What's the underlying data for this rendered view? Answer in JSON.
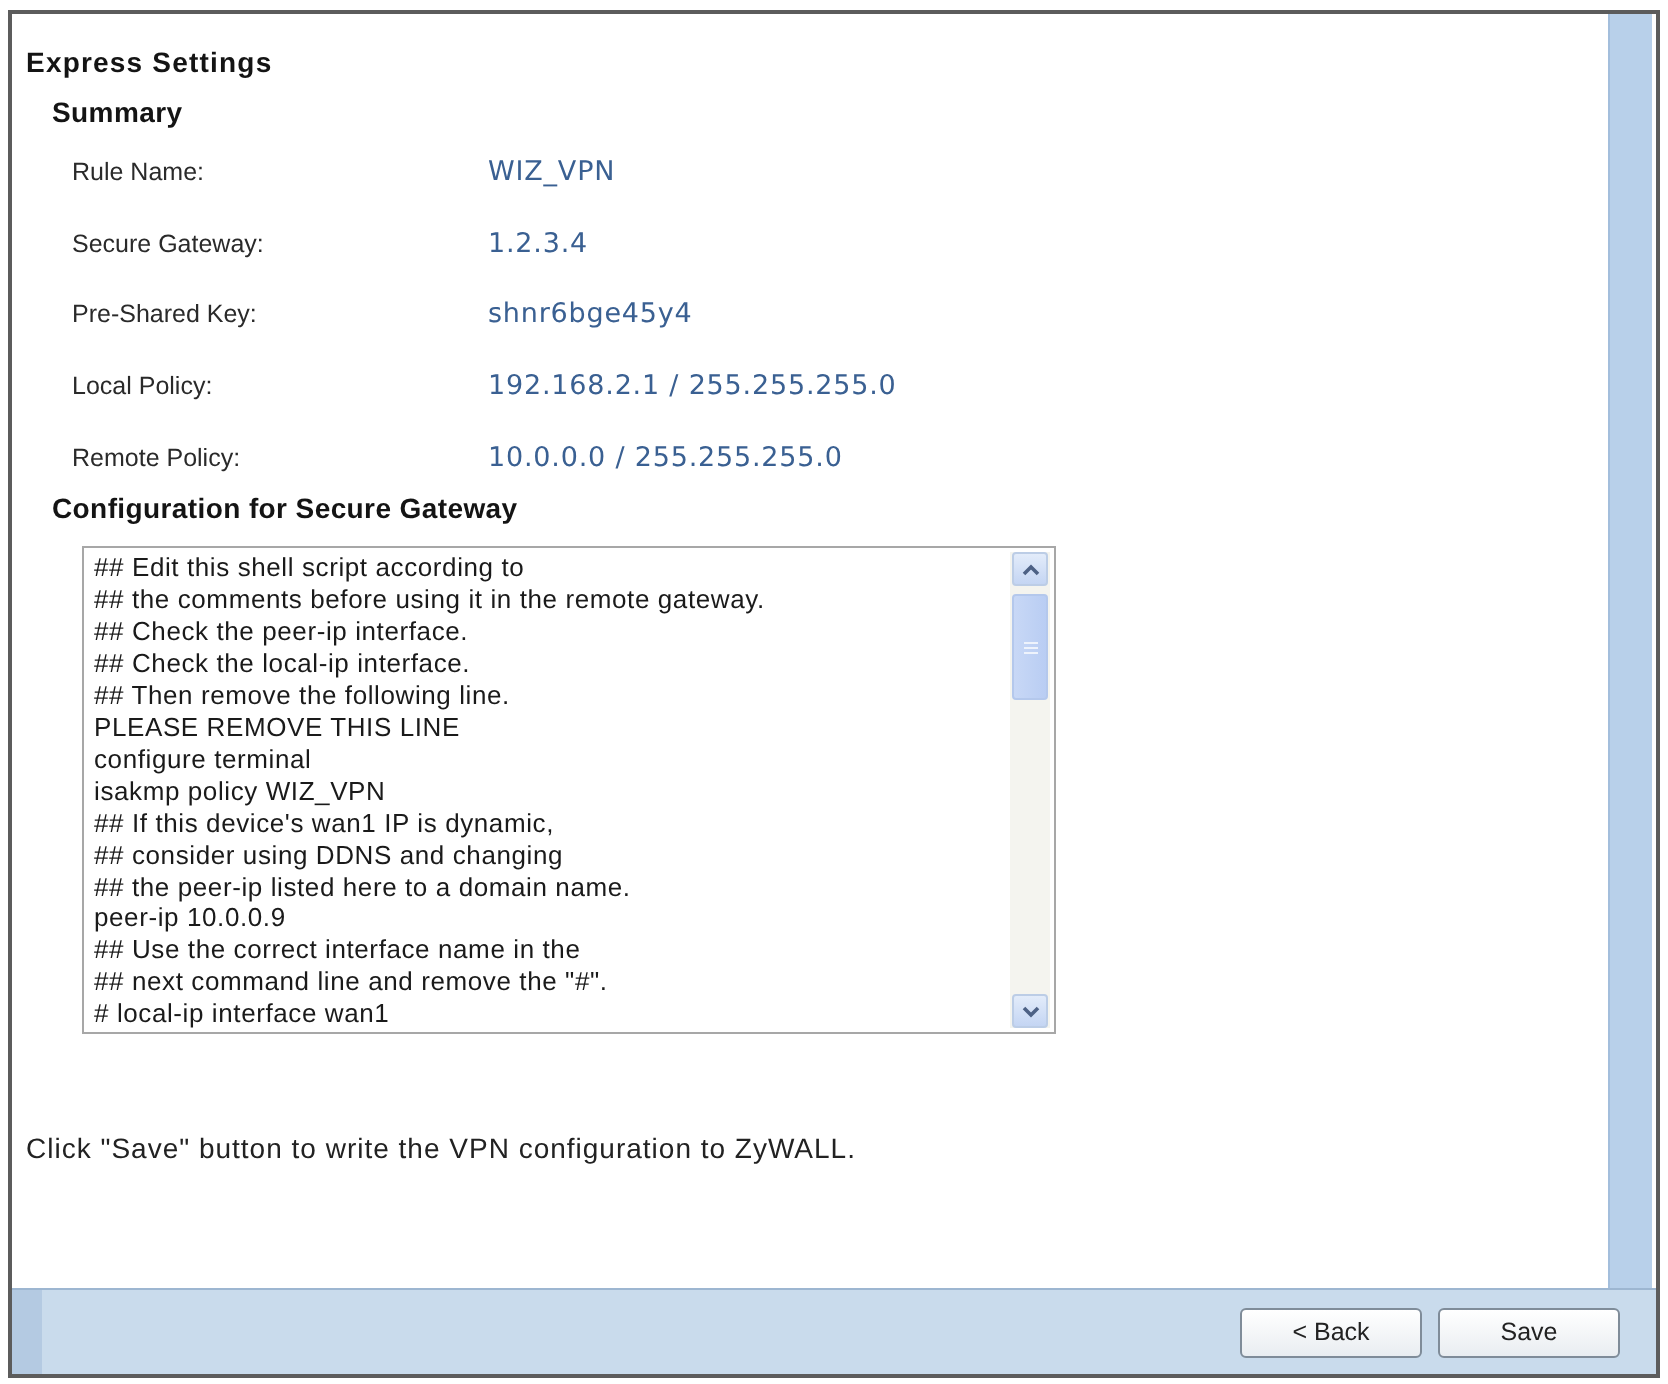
{
  "dialog": {
    "title": "Express Settings"
  },
  "summary": {
    "heading": "Summary",
    "rows": [
      {
        "label": "Rule Name:",
        "value": "WIZ_VPN"
      },
      {
        "label": "Secure Gateway:",
        "value": "1.2.3.4"
      },
      {
        "label": "Pre-Shared Key:",
        "value": "shnr6bge45y4"
      },
      {
        "label": "Local Policy:",
        "value": "192.168.2.1 / 255.255.255.0"
      },
      {
        "label": "Remote Policy:",
        "value": "10.0.0.0 / 255.255.255.0"
      }
    ]
  },
  "configuration": {
    "heading": "Configuration for Secure Gateway",
    "script_lines": [
      "## Edit this shell script according to",
      "## the comments before using it in the remote gateway.",
      "## Check the peer-ip interface.",
      "## Check the local-ip interface.",
      "## Then remove the following line.",
      "PLEASE REMOVE THIS LINE",
      "configure terminal",
      "isakmp policy WIZ_VPN",
      "## If this device's wan1 IP is dynamic,",
      "## consider using DDNS and changing",
      "## the peer-ip listed here to a domain name.",
      "peer-ip 10.0.0.9",
      "## Use the correct interface name in the",
      "## next command line and remove the \"#\".",
      "# local-ip interface wan1"
    ]
  },
  "note": "Click \"Save\" button to write the VPN configuration to ZyWALL.",
  "buttons": [
    {
      "label": "< Back"
    },
    {
      "label": "Save"
    }
  ]
}
